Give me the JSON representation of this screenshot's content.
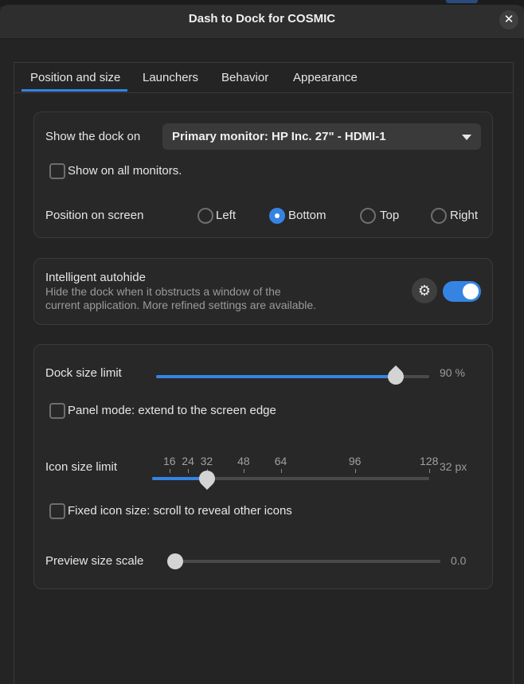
{
  "window": {
    "title": "Dash to Dock for COSMIC",
    "close_glyph": "✕"
  },
  "tabs": [
    {
      "label": "Position and size",
      "active": true
    },
    {
      "label": "Launchers"
    },
    {
      "label": "Behavior"
    },
    {
      "label": "Appearance"
    }
  ],
  "position": {
    "show_on_label": "Show the dock on",
    "monitor_value": "Primary monitor: HP Inc. 27\" - HDMI-1",
    "all_monitors_label": "Show on all monitors.",
    "all_monitors_checked": false,
    "screen_position_label": "Position on screen",
    "options": [
      "Left",
      "Bottom",
      "Top",
      "Right"
    ],
    "selected": "Bottom"
  },
  "autohide": {
    "title": "Intelligent autohide",
    "description_line1": "Hide the dock when it obstructs a window of the",
    "description_line2": "current application. More refined settings are available.",
    "settings_icon": "gear-icon",
    "settings_glyph": "⚙",
    "enabled": true
  },
  "size": {
    "dock_size_label": "Dock size limit",
    "dock_size_fraction": 0.9,
    "dock_size_value": "90 %",
    "panel_mode_label": "Panel mode: extend to the screen edge",
    "panel_mode_checked": false,
    "icon_size_label": "Icon size limit",
    "icon_size_marks": [
      "16",
      "24",
      "32",
      "48",
      "64",
      "96",
      "128"
    ],
    "icon_size_current": 32,
    "icon_size_value": "32 px",
    "fixed_icon_label": "Fixed icon size: scroll to reveal other icons",
    "fixed_icon_checked": false,
    "preview_label": "Preview size scale",
    "preview_fraction": 0.0,
    "preview_value": "0.0"
  },
  "colors": {
    "accent": "#3584e4",
    "background": "#242424",
    "card": "#282828"
  }
}
